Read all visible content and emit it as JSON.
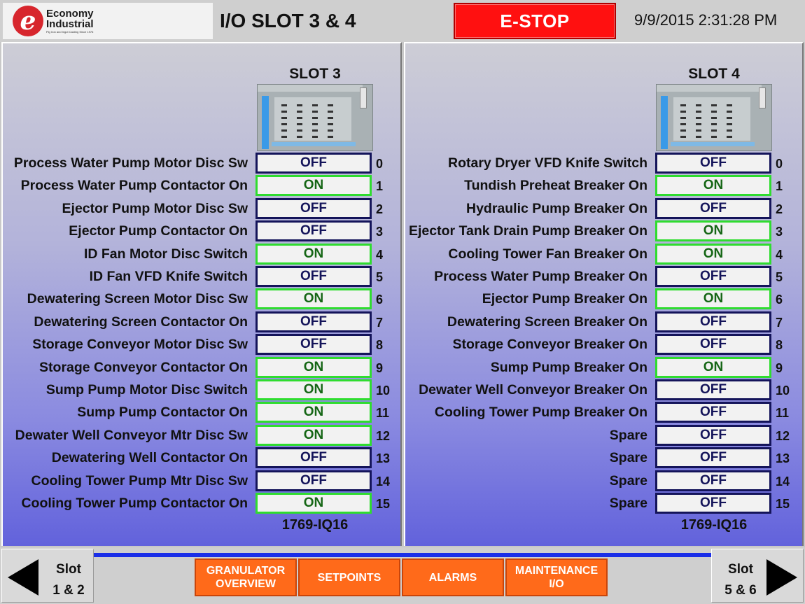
{
  "header": {
    "logo_line1": "Economy",
    "logo_line2": "Industrial",
    "logo_tagline": "Pig Iron and Ingot Casting Since 1976",
    "logo_mark": "e",
    "title": "I/O SLOT 3 & 4",
    "estop_label": "E-STOP",
    "datetime": "9/9/2015 2:31:28 PM"
  },
  "slot3": {
    "title": "SLOT 3",
    "catalog": "1769-IQ16",
    "rows": [
      {
        "label": "Process Water Pump Motor Disc Sw",
        "state": "OFF",
        "num": "0"
      },
      {
        "label": "Process Water Pump Contactor On",
        "state": "ON",
        "num": "1"
      },
      {
        "label": "Ejector Pump Motor Disc Sw",
        "state": "OFF",
        "num": "2"
      },
      {
        "label": "Ejector Pump Contactor On",
        "state": "OFF",
        "num": "3"
      },
      {
        "label": "ID Fan Motor Disc Switch",
        "state": "ON",
        "num": "4"
      },
      {
        "label": "ID Fan VFD Knife Switch",
        "state": "OFF",
        "num": "5"
      },
      {
        "label": "Dewatering Screen Motor Disc Sw",
        "state": "ON",
        "num": "6"
      },
      {
        "label": "Dewatering Screen Contactor On",
        "state": "OFF",
        "num": "7"
      },
      {
        "label": "Storage Conveyor Motor Disc Sw",
        "state": "OFF",
        "num": "8"
      },
      {
        "label": "Storage Conveyor Contactor On",
        "state": "ON",
        "num": "9"
      },
      {
        "label": "Sump Pump Motor Disc Switch",
        "state": "ON",
        "num": "10"
      },
      {
        "label": "Sump Pump Contactor On",
        "state": "ON",
        "num": "11"
      },
      {
        "label": "Dewater Well Conveyor Mtr Disc Sw",
        "state": "ON",
        "num": "12"
      },
      {
        "label": "Dewatering Well Contactor On",
        "state": "OFF",
        "num": "13"
      },
      {
        "label": "Cooling Tower Pump Mtr Disc Sw",
        "state": "OFF",
        "num": "14"
      },
      {
        "label": "Cooling Tower Pump Contactor On",
        "state": "ON",
        "num": "15"
      }
    ]
  },
  "slot4": {
    "title": "SLOT 4",
    "catalog": "1769-IQ16",
    "rows": [
      {
        "label": "Rotary Dryer VFD Knife Switch",
        "state": "OFF",
        "num": "0"
      },
      {
        "label": "Tundish Preheat Breaker On",
        "state": "ON",
        "num": "1"
      },
      {
        "label": "Hydraulic Pump Breaker On",
        "state": "OFF",
        "num": "2"
      },
      {
        "label": "Ejector Tank Drain Pump Breaker On",
        "state": "ON",
        "num": "3"
      },
      {
        "label": "Cooling Tower Fan Breaker On",
        "state": "ON",
        "num": "4"
      },
      {
        "label": "Process Water Pump Breaker On",
        "state": "OFF",
        "num": "5"
      },
      {
        "label": "Ejector Pump Breaker On",
        "state": "ON",
        "num": "6"
      },
      {
        "label": "Dewatering Screen Breaker On",
        "state": "OFF",
        "num": "7"
      },
      {
        "label": "Storage Conveyor Breaker On",
        "state": "OFF",
        "num": "8"
      },
      {
        "label": "Sump Pump Breaker On",
        "state": "ON",
        "num": "9"
      },
      {
        "label": "Dewater Well Conveyor Breaker On",
        "state": "OFF",
        "num": "10"
      },
      {
        "label": "Cooling Tower Pump Breaker On",
        "state": "OFF",
        "num": "11"
      },
      {
        "label": "Spare",
        "state": "OFF",
        "num": "12"
      },
      {
        "label": "Spare",
        "state": "OFF",
        "num": "13"
      },
      {
        "label": "Spare",
        "state": "OFF",
        "num": "14"
      },
      {
        "label": "Spare",
        "state": "OFF",
        "num": "15"
      }
    ]
  },
  "footer": {
    "prev_line1": "Slot",
    "prev_line2": "1 & 2",
    "next_line1": "Slot",
    "next_line2": "5 & 6",
    "buttons": [
      {
        "line1": "GRANULATOR",
        "line2": "OVERVIEW"
      },
      {
        "line1": "SETPOINTS",
        "line2": ""
      },
      {
        "line1": "ALARMS",
        "line2": ""
      },
      {
        "line1": "MAINTENANCE",
        "line2": "I/O"
      }
    ]
  },
  "colors": {
    "estop": "#ff1010",
    "on_border": "#2fdc2f",
    "off_border": "#14145a",
    "nav_button": "#ff6a1a"
  }
}
